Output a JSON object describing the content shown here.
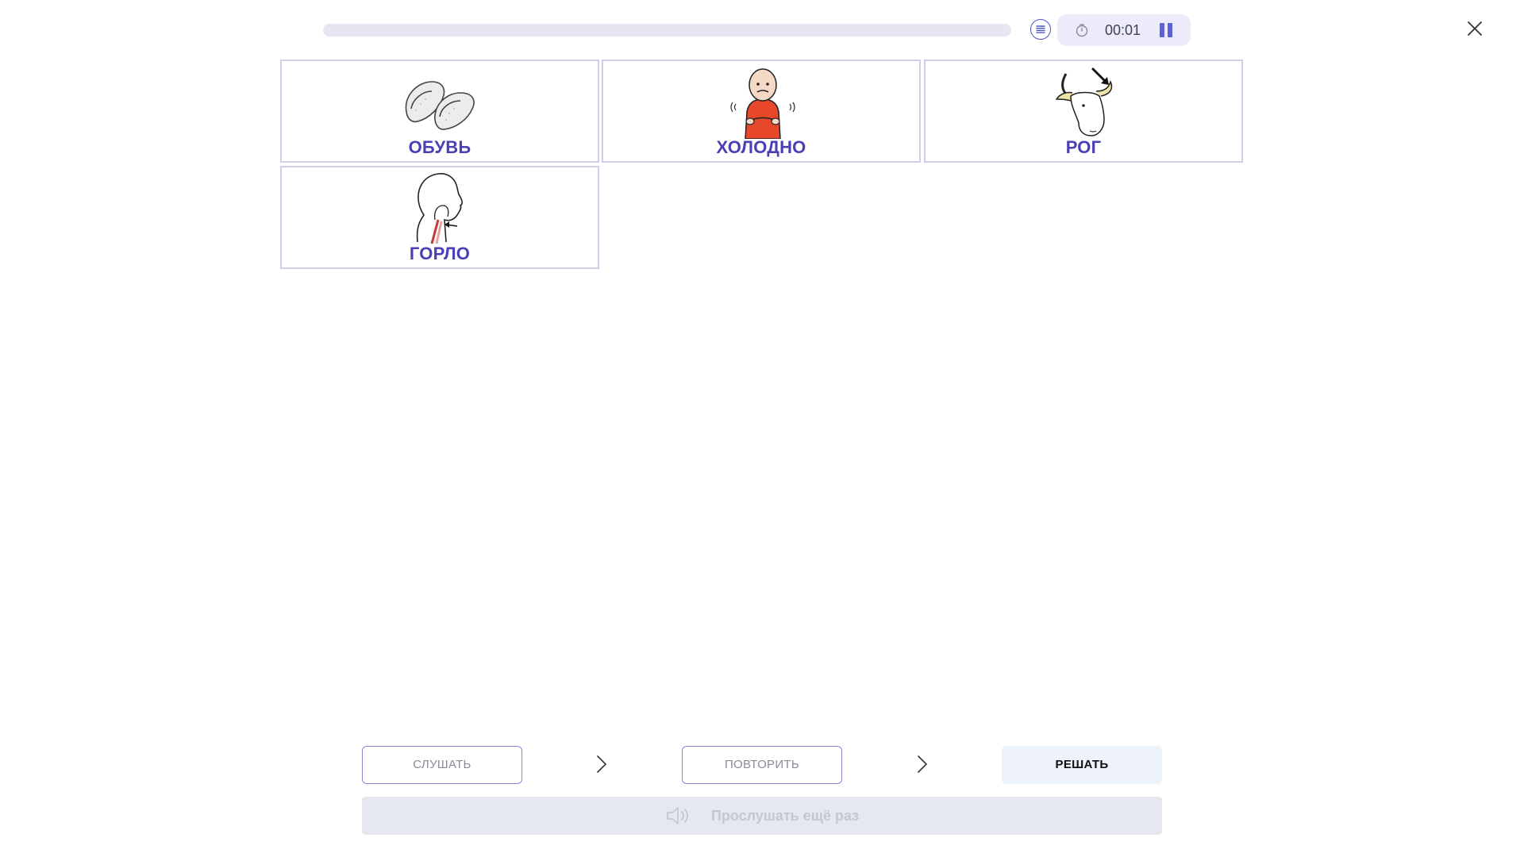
{
  "header": {
    "progress_fraction": 0,
    "timer": "00:01",
    "accent_color": "#5b5fd8"
  },
  "cards": [
    {
      "label": "ОБУВЬ",
      "icon": "slippers-icon"
    },
    {
      "label": "ХОЛОДНО",
      "icon": "cold-person-icon"
    },
    {
      "label": "РОГ",
      "icon": "bull-horn-icon"
    },
    {
      "label": "ГОРЛО",
      "icon": "throat-icon"
    }
  ],
  "steps": {
    "listen": "СЛУШАТЬ",
    "repeat": "ПОВТОРИТЬ",
    "solve": "РЕШАТЬ"
  },
  "listen_again": {
    "label": "Прослушать ещё раз",
    "icon": "speaker-icon"
  },
  "colors": {
    "card_label": "#4a3fb4",
    "card_border": "#cfcdea",
    "active_step_bg": "#eef2fb"
  }
}
